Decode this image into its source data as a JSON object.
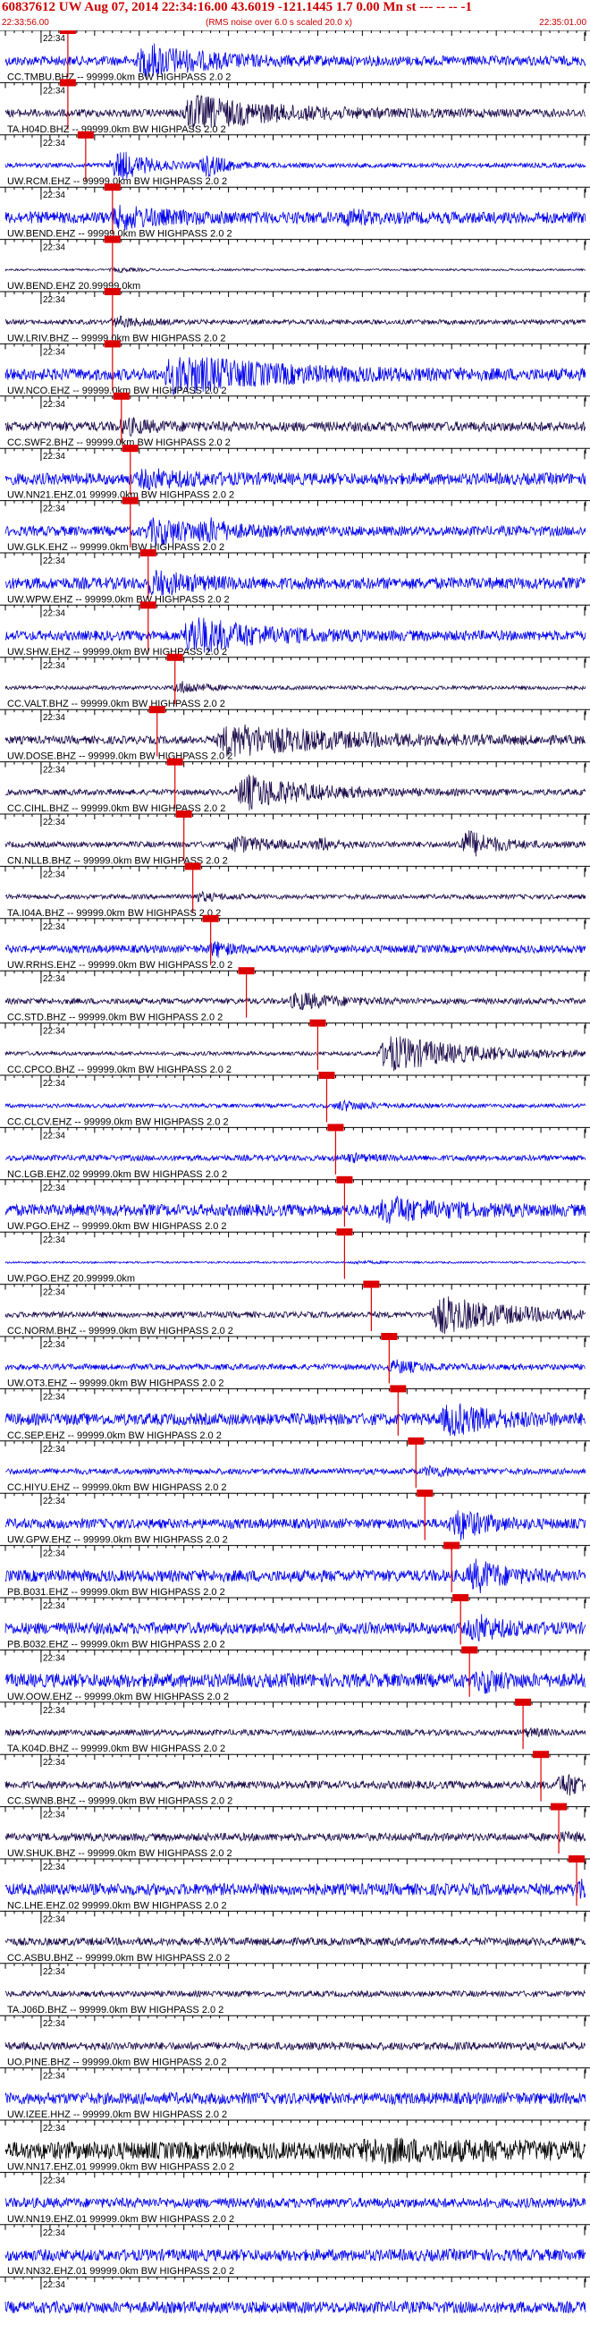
{
  "header": {
    "title": "60837612 UW Aug 07, 2014 22:34:16.00   43.6019 -121.1445  1.7 0.00 Mn st --- -- --  -1",
    "start_time": "22:33:56.00",
    "noise_note": "(RMS noise over 6.0 s scaled 20.0 x)",
    "end_time": "22:35:01.00"
  },
  "colors": {
    "dark": "#1a0a4a",
    "blue": "#0000ee",
    "black": "#000000",
    "pick": "#dd0000"
  },
  "chart_data": {
    "type": "line",
    "title": "60837612 UW Aug 07, 2014 22:34:16.00   43.6019 -121.1445  1.7 0.00 Mn st --- -- --  -1",
    "xlabel": "",
    "ylabel": "",
    "x_range": [
      "22:33:56.00",
      "22:35:01.00"
    ],
    "tick_label": "22:34",
    "tick_label_sec": 4,
    "traces": [
      {
        "label": "CC.TMBU.BHZ -- 99999.0km BW  HIGHPASS  2.0  2",
        "color": "blue",
        "pick_sec": 7,
        "events": [
          {
            "t": 15,
            "amp": 0.9,
            "w": 12
          }
        ],
        "noise": 0.25
      },
      {
        "label": "TA.H04D.BHZ -- 99999.0km BW  HIGHPASS  2.0  2",
        "color": "dark",
        "pick_sec": 7,
        "events": [
          {
            "t": 20,
            "amp": 0.9,
            "w": 18
          }
        ],
        "noise": 0.2
      },
      {
        "label": "UW.RCM.EHZ -- 99999.0km BW  HIGHPASS  2.0  2",
        "color": "blue",
        "pick_sec": 9,
        "events": [
          {
            "t": 12,
            "amp": 1.0,
            "w": 6
          },
          {
            "t": 22,
            "amp": 0.8,
            "w": 4
          }
        ],
        "noise": 0.12
      },
      {
        "label": "UW.BEND.EHZ -- 99999.0km BW  HIGHPASS  2.0  2",
        "color": "blue",
        "pick_sec": 12,
        "events": [
          {
            "t": 12,
            "amp": 0.5,
            "w": 10
          },
          {
            "t": 38,
            "amp": 0.35,
            "w": 4
          }
        ],
        "noise": 0.3
      },
      {
        "label": "UW.BEND.EHZ 20.99999.0km",
        "color": "dark",
        "pick_sec": 12,
        "events": [
          {
            "t": 12,
            "amp": 0.15,
            "w": 4
          }
        ],
        "noise": 0.05
      },
      {
        "label": "UW.LRIV.BHZ -- 99999.0km BW  HIGHPASS  2.0  2",
        "color": "dark",
        "pick_sec": 12,
        "events": [
          {
            "t": 12,
            "amp": 0.3,
            "w": 6
          }
        ],
        "noise": 0.12
      },
      {
        "label": "UW.NCO.EHZ -- 99999.0km BW  HIGHPASS  2.0  2",
        "color": "blue",
        "pick_sec": 12,
        "events": [
          {
            "t": 18,
            "amp": 1.0,
            "w": 20
          }
        ],
        "noise": 0.3
      },
      {
        "label": "CC.SWF2.BHZ -- 99999.0km BW  HIGHPASS  2.0  2",
        "color": "dark",
        "pick_sec": 13,
        "events": [
          {
            "t": 13,
            "amp": 0.4,
            "w": 5
          }
        ],
        "noise": 0.25
      },
      {
        "label": "UW.NN21.EHZ.01 99999.0km BW  HIGHPASS  2.0  2",
        "color": "blue",
        "pick_sec": 14,
        "events": [
          {
            "t": 15,
            "amp": 0.4,
            "w": 10
          }
        ],
        "noise": 0.3
      },
      {
        "label": "UW.GLK.EHZ -- 99999.0km BW  HIGHPASS  2.0  2",
        "color": "blue",
        "pick_sec": 14,
        "events": [
          {
            "t": 16,
            "amp": 0.7,
            "w": 10
          },
          {
            "t": 22,
            "amp": 0.5,
            "w": 4
          }
        ],
        "noise": 0.25
      },
      {
        "label": "UW.WPW.EHZ -- 99999.0km BW  HIGHPASS  2.0  2",
        "color": "blue",
        "pick_sec": 16,
        "events": [
          {
            "t": 16,
            "amp": 0.6,
            "w": 8
          }
        ],
        "noise": 0.3
      },
      {
        "label": "UW.SHW.EHZ -- 99999.0km BW  HIGHPASS  2.0  2",
        "color": "blue",
        "pick_sec": 16,
        "events": [
          {
            "t": 20,
            "amp": 1.0,
            "w": 14
          }
        ],
        "noise": 0.25
      },
      {
        "label": "CC.VALT.BHZ -- 99999.0km BW  HIGHPASS  2.0  2",
        "color": "dark",
        "pick_sec": 19,
        "events": [
          {
            "t": 19,
            "amp": 0.4,
            "w": 5
          }
        ],
        "noise": 0.1
      },
      {
        "label": "UW.DOSE.BHZ -- 99999.0km BW  HIGHPASS  2.0  2",
        "color": "dark",
        "pick_sec": 17,
        "events": [
          {
            "t": 24,
            "amp": 0.8,
            "w": 26
          }
        ],
        "noise": 0.2
      },
      {
        "label": "CC.CIHL.BHZ -- 99999.0km BW  HIGHPASS  2.0  2",
        "color": "dark",
        "pick_sec": 19,
        "events": [
          {
            "t": 26,
            "amp": 0.95,
            "w": 14
          }
        ],
        "noise": 0.15
      },
      {
        "label": "CN.NLLB.BHZ -- 99999.0km BW  HIGHPASS  2.0  2",
        "color": "dark",
        "pick_sec": 20,
        "events": [
          {
            "t": 25,
            "amp": 0.45,
            "w": 8
          },
          {
            "t": 35,
            "amp": 0.4,
            "w": 3
          },
          {
            "t": 51,
            "amp": 0.9,
            "w": 6
          }
        ],
        "noise": 0.15
      },
      {
        "label": "TA.I04A.BHZ -- 99999.0km BW  HIGHPASS  2.0  2",
        "color": "dark",
        "pick_sec": 21,
        "events": [
          {
            "t": 21,
            "amp": 0.25,
            "w": 5
          }
        ],
        "noise": 0.12
      },
      {
        "label": "UW.RRHS.EHZ -- 99999.0km BW  HIGHPASS  2.0  2",
        "color": "blue",
        "pick_sec": 23,
        "events": [
          {
            "t": 23,
            "amp": 0.5,
            "w": 3
          }
        ],
        "noise": 0.2
      },
      {
        "label": "CC.STD.BHZ -- 99999.0km BW  HIGHPASS  2.0  2",
        "color": "dark",
        "pick_sec": 27,
        "events": [
          {
            "t": 32,
            "amp": 0.5,
            "w": 8
          }
        ],
        "noise": 0.15
      },
      {
        "label": "CC.CPCO.BHZ -- 99999.0km BW  HIGHPASS  2.0  2",
        "color": "dark",
        "pick_sec": 35,
        "events": [
          {
            "t": 42,
            "amp": 1.0,
            "w": 18
          }
        ],
        "noise": 0.1
      },
      {
        "label": "CC.CLCV.EHZ -- 99999.0km BW  HIGHPASS  2.0  2",
        "color": "blue",
        "pick_sec": 36,
        "events": [
          {
            "t": 37,
            "amp": 0.3,
            "w": 6
          }
        ],
        "noise": 0.1
      },
      {
        "label": "NC.LGB.EHZ.02 99999.0km BW  HIGHPASS  2.0  2",
        "color": "blue",
        "pick_sec": 37,
        "events": [
          {
            "t": 38,
            "amp": 0.2,
            "w": 5
          }
        ],
        "noise": 0.15
      },
      {
        "label": "UW.PGO.EHZ -- 99999.0km BW  HIGHPASS  2.0  2",
        "color": "blue",
        "pick_sec": 38,
        "events": [
          {
            "t": 42,
            "amp": 0.6,
            "w": 12
          }
        ],
        "noise": 0.3
      },
      {
        "label": "UW.PGO.EHZ 20.99999.0km",
        "color": "blue",
        "pick_sec": 38,
        "events": [
          {
            "t": 39,
            "amp": 0.1,
            "w": 4
          }
        ],
        "noise": 0.05
      },
      {
        "label": "CC.NORM.BHZ -- 99999.0km BW  HIGHPASS  2.0  2",
        "color": "dark",
        "pick_sec": 41,
        "events": [
          {
            "t": 48,
            "amp": 1.0,
            "w": 16
          }
        ],
        "noise": 0.15
      },
      {
        "label": "UW.OT3.EHZ -- 99999.0km BW  HIGHPASS  2.0  2",
        "color": "blue",
        "pick_sec": 43,
        "events": [
          {
            "t": 43,
            "amp": 0.35,
            "w": 6
          }
        ],
        "noise": 0.15
      },
      {
        "label": "CC.SEP.EHZ -- 99999.0km BW  HIGHPASS  2.0  2",
        "color": "blue",
        "pick_sec": 44,
        "events": [
          {
            "t": 49,
            "amp": 0.8,
            "w": 10
          }
        ],
        "noise": 0.3
      },
      {
        "label": "CC.HIYU.EHZ -- 99999.0km BW  HIGHPASS  2.0  2",
        "color": "blue",
        "pick_sec": 46,
        "events": [
          {
            "t": 47,
            "amp": 0.3,
            "w": 5
          }
        ],
        "noise": 0.15
      },
      {
        "label": "UW.GPW.EHZ -- 99999.0km BW  HIGHPASS  2.0  2",
        "color": "blue",
        "pick_sec": 47,
        "events": [
          {
            "t": 50,
            "amp": 0.9,
            "w": 6
          }
        ],
        "noise": 0.25
      },
      {
        "label": "PB.B031.EHZ -- 99999.0km BW  HIGHPASS  2.0  2",
        "color": "blue",
        "pick_sec": 50,
        "events": [
          {
            "t": 52,
            "amp": 0.9,
            "w": 6
          }
        ],
        "noise": 0.3
      },
      {
        "label": "PB.B032.EHZ -- 99999.0km BW  HIGHPASS  2.0  2",
        "color": "blue",
        "pick_sec": 51,
        "events": [
          {
            "t": 52,
            "amp": 0.7,
            "w": 6
          }
        ],
        "noise": 0.3
      },
      {
        "label": "UW.OOW.EHZ -- 99999.0km BW  HIGHPASS  2.0  2",
        "color": "blue",
        "pick_sec": 52,
        "events": [
          {
            "t": 53,
            "amp": 0.6,
            "w": 4
          }
        ],
        "noise": 0.35
      },
      {
        "label": "TA.K04D.BHZ -- 99999.0km BW  HIGHPASS  2.0  2",
        "color": "dark",
        "pick_sec": 58,
        "events": [
          {
            "t": 58,
            "amp": 0.2,
            "w": 4
          }
        ],
        "noise": 0.15
      },
      {
        "label": "CC.SWNB.BHZ -- 99999.0km BW  HIGHPASS  2.0  2",
        "color": "dark",
        "pick_sec": 60,
        "events": [
          {
            "t": 62,
            "amp": 0.7,
            "w": 5
          }
        ],
        "noise": 0.2
      },
      {
        "label": "UW.SHUK.BHZ -- 99999.0km BW  HIGHPASS  2.0  2",
        "color": "dark",
        "pick_sec": 62,
        "events": [
          {
            "t": 62,
            "amp": 0.2,
            "w": 3
          }
        ],
        "noise": 0.2
      },
      {
        "label": "NC.LHE.EHZ.02 99999.0km BW  HIGHPASS  2.0  2",
        "color": "blue",
        "pick_sec": 64,
        "events": [
          {
            "t": 64,
            "amp": 0.8,
            "w": 2
          }
        ],
        "noise": 0.3
      },
      {
        "label": "CC.ASBU.BHZ -- 99999.0km BW  HIGHPASS  2.0  2",
        "color": "dark",
        "events": [],
        "noise": 0.2
      },
      {
        "label": "TA.J06D.BHZ -- 99999.0km BW  HIGHPASS  2.0  2",
        "color": "dark",
        "events": [],
        "noise": 0.15
      },
      {
        "label": "UO.PINE.BHZ -- 99999.0km BW  HIGHPASS  2.0  2",
        "color": "dark",
        "events": [],
        "noise": 0.2
      },
      {
        "label": "UW.IZEE.HHZ -- 99999.0km BW  HIGHPASS  2.0  2",
        "color": "blue",
        "events": [],
        "noise": 0.3
      },
      {
        "label": "UW.NN17.EHZ.01 99999.0km BW  HIGHPASS  2.0  2",
        "color": "black",
        "events": [
          {
            "t": 40,
            "amp": 0.3,
            "w": 30
          }
        ],
        "noise": 0.45
      },
      {
        "label": "UW.NN19.EHZ.01 99999.0km BW  HIGHPASS  2.0  2",
        "color": "blue",
        "events": [],
        "noise": 0.25
      },
      {
        "label": "UW.NN32.EHZ.01 99999.0km BW  HIGHPASS  2.0  2",
        "color": "blue",
        "events": [],
        "noise": 0.3
      },
      {
        "label": "",
        "color": "blue",
        "events": [],
        "noise": 0.3
      }
    ]
  }
}
